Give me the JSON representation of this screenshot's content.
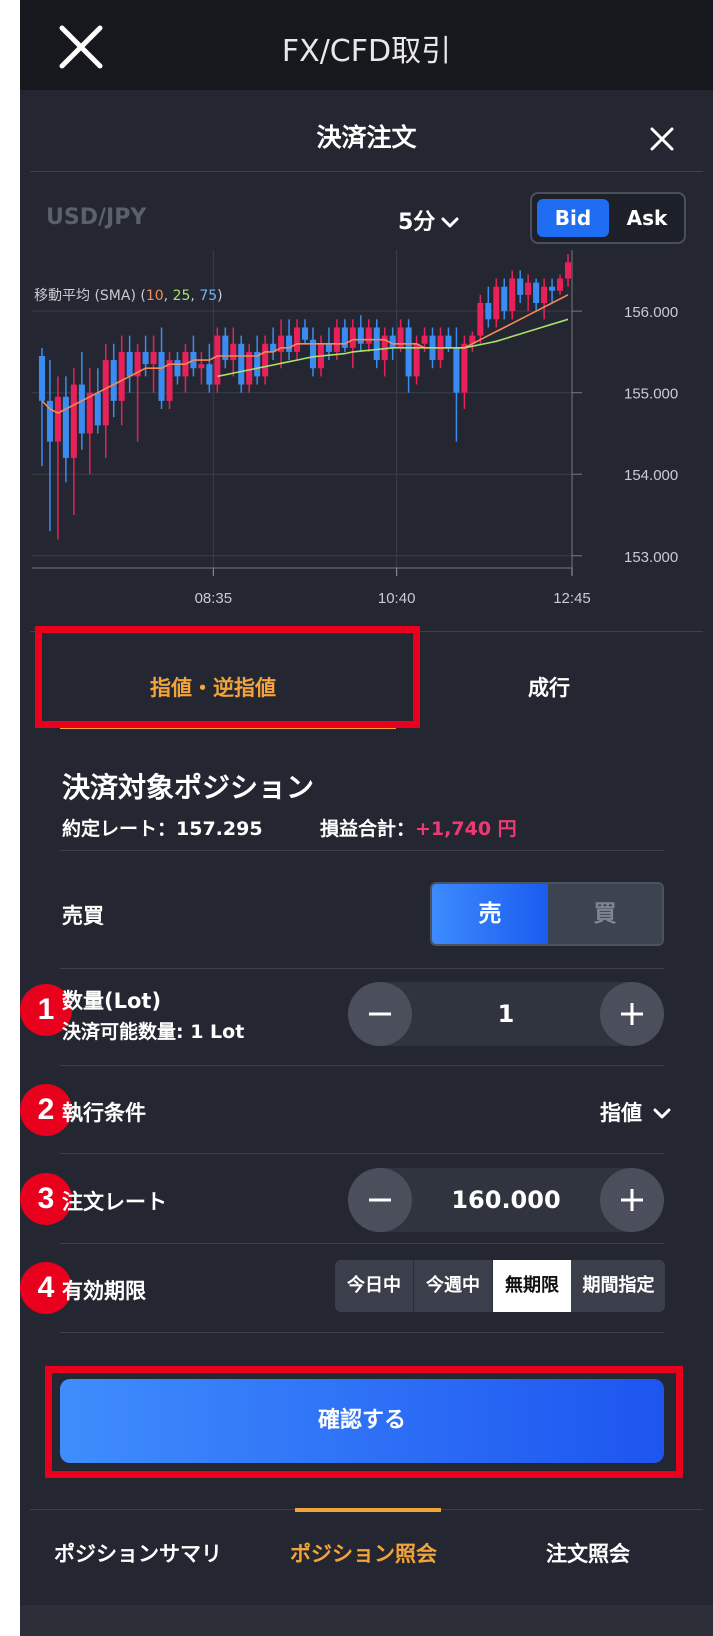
{
  "header": {
    "title": "FX/CFD取引",
    "close_icon": "close-icon"
  },
  "sheet": {
    "title": "決済注文",
    "close_icon": "close-icon"
  },
  "chart_bar": {
    "symbol": "USD/JPY",
    "interval": "5分",
    "bid_label": "Bid",
    "ask_label": "Ask",
    "selected": "Bid",
    "bid_color": "#1f6df2"
  },
  "chart_data": {
    "type": "candlestick",
    "sma_label": "移動平均 (SMA) (",
    "sma_periods": [
      "10",
      "25",
      "75"
    ],
    "sma_colors": [
      "#f28a5c",
      "#a8e06a",
      "#6fb5f0"
    ],
    "y_ticks": [
      "156.000",
      "155.000",
      "154.000",
      "153.000"
    ],
    "x_ticks": [
      "08:35",
      "10:40",
      "12:45"
    ],
    "ylim": [
      152.85,
      156.75
    ],
    "up_color": "#e8215a",
    "down_color": "#3b8cf0",
    "candles": [
      {
        "o": 155.45,
        "h": 155.55,
        "l": 154.1,
        "c": 154.9,
        "up": false
      },
      {
        "o": 154.9,
        "h": 155.4,
        "l": 153.3,
        "c": 154.4,
        "up": false
      },
      {
        "o": 154.4,
        "h": 155.2,
        "l": 153.2,
        "c": 154.95,
        "up": true
      },
      {
        "o": 154.95,
        "h": 155.2,
        "l": 153.9,
        "c": 154.2,
        "up": false
      },
      {
        "o": 154.2,
        "h": 155.3,
        "l": 153.5,
        "c": 155.1,
        "up": true
      },
      {
        "o": 155.1,
        "h": 155.5,
        "l": 154.3,
        "c": 154.5,
        "up": false
      },
      {
        "o": 154.5,
        "h": 155.3,
        "l": 154.0,
        "c": 155.0,
        "up": true
      },
      {
        "o": 155.0,
        "h": 155.3,
        "l": 154.5,
        "c": 154.6,
        "up": false
      },
      {
        "o": 154.6,
        "h": 155.6,
        "l": 154.2,
        "c": 155.4,
        "up": true
      },
      {
        "o": 155.4,
        "h": 155.6,
        "l": 154.7,
        "c": 154.9,
        "up": false
      },
      {
        "o": 154.9,
        "h": 155.7,
        "l": 154.6,
        "c": 155.5,
        "up": true
      },
      {
        "o": 155.5,
        "h": 155.7,
        "l": 155.0,
        "c": 155.2,
        "up": false
      },
      {
        "o": 155.2,
        "h": 155.6,
        "l": 154.4,
        "c": 155.5,
        "up": true
      },
      {
        "o": 155.5,
        "h": 155.7,
        "l": 155.2,
        "c": 155.35,
        "up": false
      },
      {
        "o": 155.35,
        "h": 155.7,
        "l": 155.0,
        "c": 155.5,
        "up": true
      },
      {
        "o": 155.5,
        "h": 155.8,
        "l": 154.8,
        "c": 154.9,
        "up": false
      },
      {
        "o": 154.9,
        "h": 155.5,
        "l": 154.8,
        "c": 155.4,
        "up": true
      },
      {
        "o": 155.4,
        "h": 155.5,
        "l": 155.1,
        "c": 155.2,
        "up": false
      },
      {
        "o": 155.2,
        "h": 155.6,
        "l": 155.0,
        "c": 155.5,
        "up": true
      },
      {
        "o": 155.5,
        "h": 155.7,
        "l": 155.2,
        "c": 155.3,
        "up": false
      },
      {
        "o": 155.3,
        "h": 155.5,
        "l": 155.1,
        "c": 155.35,
        "up": true
      },
      {
        "o": 155.35,
        "h": 155.6,
        "l": 155.0,
        "c": 155.1,
        "up": false
      },
      {
        "o": 155.1,
        "h": 155.8,
        "l": 155.0,
        "c": 155.7,
        "up": true
      },
      {
        "o": 155.7,
        "h": 155.8,
        "l": 155.3,
        "c": 155.4,
        "up": false
      },
      {
        "o": 155.4,
        "h": 155.8,
        "l": 155.2,
        "c": 155.6,
        "up": true
      },
      {
        "o": 155.6,
        "h": 155.7,
        "l": 155.0,
        "c": 155.1,
        "up": false
      },
      {
        "o": 155.1,
        "h": 155.6,
        "l": 155.0,
        "c": 155.5,
        "up": true
      },
      {
        "o": 155.5,
        "h": 155.7,
        "l": 155.1,
        "c": 155.2,
        "up": false
      },
      {
        "o": 155.2,
        "h": 155.7,
        "l": 155.1,
        "c": 155.6,
        "up": true
      },
      {
        "o": 155.6,
        "h": 155.8,
        "l": 155.4,
        "c": 155.5,
        "up": false
      },
      {
        "o": 155.5,
        "h": 155.9,
        "l": 155.3,
        "c": 155.7,
        "up": true
      },
      {
        "o": 155.7,
        "h": 155.9,
        "l": 155.4,
        "c": 155.5,
        "up": false
      },
      {
        "o": 155.5,
        "h": 155.9,
        "l": 155.4,
        "c": 155.8,
        "up": true
      },
      {
        "o": 155.8,
        "h": 155.9,
        "l": 155.6,
        "c": 155.65,
        "up": false
      },
      {
        "o": 155.65,
        "h": 155.8,
        "l": 155.2,
        "c": 155.3,
        "up": false
      },
      {
        "o": 155.3,
        "h": 155.7,
        "l": 155.2,
        "c": 155.6,
        "up": true
      },
      {
        "o": 155.6,
        "h": 155.8,
        "l": 155.4,
        "c": 155.5,
        "up": false
      },
      {
        "o": 155.5,
        "h": 155.9,
        "l": 155.4,
        "c": 155.8,
        "up": true
      },
      {
        "o": 155.8,
        "h": 155.9,
        "l": 155.5,
        "c": 155.55,
        "up": false
      },
      {
        "o": 155.55,
        "h": 155.9,
        "l": 155.3,
        "c": 155.8,
        "up": true
      },
      {
        "o": 155.8,
        "h": 155.95,
        "l": 155.5,
        "c": 155.6,
        "up": false
      },
      {
        "o": 155.6,
        "h": 155.9,
        "l": 155.5,
        "c": 155.8,
        "up": true
      },
      {
        "o": 155.8,
        "h": 155.9,
        "l": 155.3,
        "c": 155.4,
        "up": false
      },
      {
        "o": 155.4,
        "h": 155.8,
        "l": 155.2,
        "c": 155.7,
        "up": true
      },
      {
        "o": 155.7,
        "h": 155.8,
        "l": 155.4,
        "c": 155.55,
        "up": false
      },
      {
        "o": 155.55,
        "h": 155.9,
        "l": 155.5,
        "c": 155.8,
        "up": true
      },
      {
        "o": 155.8,
        "h": 155.9,
        "l": 155.0,
        "c": 155.2,
        "up": false
      },
      {
        "o": 155.2,
        "h": 155.7,
        "l": 155.1,
        "c": 155.6,
        "up": true
      },
      {
        "o": 155.6,
        "h": 155.8,
        "l": 155.5,
        "c": 155.7,
        "up": true
      },
      {
        "o": 155.7,
        "h": 155.8,
        "l": 155.3,
        "c": 155.4,
        "up": false
      },
      {
        "o": 155.4,
        "h": 155.8,
        "l": 155.3,
        "c": 155.7,
        "up": true
      },
      {
        "o": 155.7,
        "h": 155.8,
        "l": 155.5,
        "c": 155.55,
        "up": false
      },
      {
        "o": 155.55,
        "h": 155.8,
        "l": 154.4,
        "c": 155.0,
        "up": false
      },
      {
        "o": 155.0,
        "h": 155.7,
        "l": 154.8,
        "c": 155.6,
        "up": true
      },
      {
        "o": 155.6,
        "h": 155.75,
        "l": 155.5,
        "c": 155.7,
        "up": true
      },
      {
        "o": 155.7,
        "h": 156.2,
        "l": 155.6,
        "c": 156.1,
        "up": true
      },
      {
        "o": 156.1,
        "h": 156.3,
        "l": 155.8,
        "c": 155.9,
        "up": false
      },
      {
        "o": 155.9,
        "h": 156.4,
        "l": 155.8,
        "c": 156.3,
        "up": true
      },
      {
        "o": 156.3,
        "h": 156.4,
        "l": 155.9,
        "c": 156.0,
        "up": false
      },
      {
        "o": 156.0,
        "h": 156.5,
        "l": 155.9,
        "c": 156.4,
        "up": true
      },
      {
        "o": 156.4,
        "h": 156.5,
        "l": 156.1,
        "c": 156.2,
        "up": false
      },
      {
        "o": 156.2,
        "h": 156.45,
        "l": 156.0,
        "c": 156.35,
        "up": true
      },
      {
        "o": 156.35,
        "h": 156.4,
        "l": 156.0,
        "c": 156.1,
        "up": false
      },
      {
        "o": 156.1,
        "h": 156.4,
        "l": 155.9,
        "c": 156.3,
        "up": true
      },
      {
        "o": 156.3,
        "h": 156.4,
        "l": 156.1,
        "c": 156.25,
        "up": false
      },
      {
        "o": 156.25,
        "h": 156.45,
        "l": 156.2,
        "c": 156.4,
        "up": true
      },
      {
        "o": 156.4,
        "h": 156.7,
        "l": 156.3,
        "c": 156.6,
        "up": true
      }
    ],
    "sma10": [
      154.9,
      154.8,
      154.75,
      154.8,
      154.85,
      154.9,
      154.95,
      155.0,
      155.05,
      155.1,
      155.15,
      155.2,
      155.25,
      155.3,
      155.3,
      155.3,
      155.35,
      155.35,
      155.35,
      155.4,
      155.4,
      155.4,
      155.45,
      155.45,
      155.45,
      155.45,
      155.45,
      155.45,
      155.5,
      155.5,
      155.55,
      155.55,
      155.6,
      155.6,
      155.6,
      155.6,
      155.6,
      155.6,
      155.6,
      155.65,
      155.65,
      155.65,
      155.65,
      155.65,
      155.6,
      155.6,
      155.6,
      155.6,
      155.55,
      155.55,
      155.55,
      155.55,
      155.55,
      155.55,
      155.6,
      155.65,
      155.7,
      155.75,
      155.8,
      155.85,
      155.9,
      155.95,
      156.0,
      156.05,
      156.1,
      156.15,
      156.2
    ],
    "sma25": [
      null,
      null,
      null,
      null,
      null,
      null,
      null,
      null,
      null,
      null,
      null,
      null,
      null,
      null,
      null,
      null,
      null,
      null,
      null,
      null,
      null,
      null,
      155.2,
      155.22,
      155.24,
      155.26,
      155.28,
      155.3,
      155.32,
      155.34,
      155.36,
      155.38,
      155.4,
      155.42,
      155.44,
      155.45,
      155.46,
      155.47,
      155.48,
      155.5,
      155.51,
      155.52,
      155.53,
      155.54,
      155.55,
      155.55,
      155.55,
      155.55,
      155.55,
      155.55,
      155.55,
      155.55,
      155.55,
      155.55,
      155.57,
      155.59,
      155.61,
      155.63,
      155.66,
      155.69,
      155.72,
      155.75,
      155.78,
      155.81,
      155.84,
      155.87,
      155.9
    ]
  },
  "order_tabs": [
    {
      "label": "指値・逆指値",
      "active": true
    },
    {
      "label": "成行",
      "active": false
    }
  ],
  "position": {
    "title": "決済対象ポジション",
    "rate_label": "約定レート：157.295",
    "pnl_label": "損益合計：",
    "pnl_value": "+1,740 円"
  },
  "form": {
    "side_label": "売買",
    "sell_label": "売",
    "buy_label": "買",
    "qty_label": "数量(Lot)",
    "qty_sub": "決済可能数量: 1 Lot",
    "qty_value": "1",
    "exec_label": "執行条件",
    "exec_value": "指値",
    "rate_label": "注文レート",
    "rate_value": "160.000",
    "expiry_label": "有効期限",
    "expiry_options": [
      "今日中",
      "今週中",
      "無期限",
      "期間指定"
    ],
    "expiry_selected": "無期限"
  },
  "badges": [
    "1",
    "2",
    "3",
    "4"
  ],
  "confirm_label": "確認する",
  "bottom_nav": [
    {
      "label": "ポジションサマリ",
      "active": false
    },
    {
      "label": "ポジション照会",
      "active": true
    },
    {
      "label": "注文照会",
      "active": false
    }
  ],
  "colors": {
    "accent": "#f2a33a",
    "highlight_red": "#e8001c",
    "pnl_positive": "#ee3a73",
    "primary_blue": "#1f6df2"
  }
}
